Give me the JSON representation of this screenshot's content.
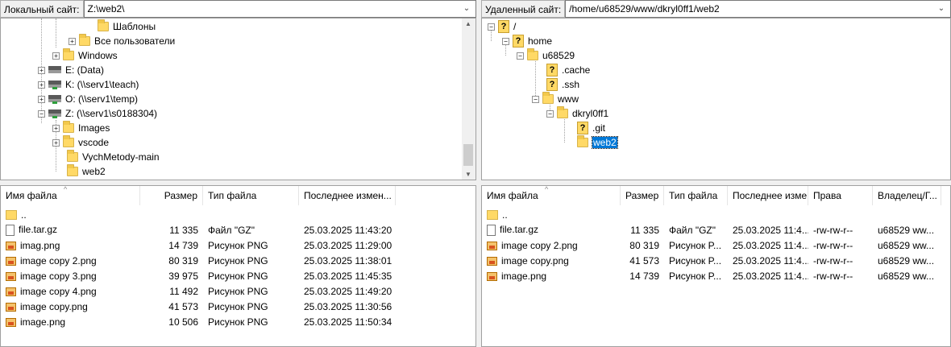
{
  "local": {
    "label": "Локальный сайт:",
    "path": "Z:\\web2\\",
    "tree": [
      {
        "label": "Шаблоны",
        "icon": "folder-icon"
      },
      {
        "label": "Все пользователи",
        "icon": "folder-icon"
      },
      {
        "label": "Windows",
        "icon": "folder-icon"
      },
      {
        "label": "E: (Data)",
        "icon": "drive-icon"
      },
      {
        "label": "K: (\\\\serv1\\teach)",
        "icon": "network-drive-icon"
      },
      {
        "label": "O: (\\\\serv1\\temp)",
        "icon": "network-drive-icon"
      },
      {
        "label": "Z: (\\\\serv1\\s0188304)",
        "icon": "network-drive-icon"
      },
      {
        "label": "Images",
        "icon": "folder-icon"
      },
      {
        "label": "vscode",
        "icon": "folder-icon"
      },
      {
        "label": "VychMetody-main",
        "icon": "folder-icon"
      },
      {
        "label": "web2",
        "icon": "folder-icon"
      }
    ],
    "columns": [
      "Имя файла",
      "Размер",
      "Тип файла",
      "Последнее измен..."
    ],
    "files": [
      {
        "name": "..",
        "size": "",
        "type": "",
        "modified": "",
        "icon": "up-folder-icon"
      },
      {
        "name": "file.tar.gz",
        "size": "11 335",
        "type": "Файл \"GZ\"",
        "modified": "25.03.2025 11:43:20",
        "icon": "file-icon"
      },
      {
        "name": "imag.png",
        "size": "14 739",
        "type": "Рисунок PNG",
        "modified": "25.03.2025 11:29:00",
        "icon": "image-icon"
      },
      {
        "name": "image copy 2.png",
        "size": "80 319",
        "type": "Рисунок PNG",
        "modified": "25.03.2025 11:38:01",
        "icon": "image-icon"
      },
      {
        "name": "image copy 3.png",
        "size": "39 975",
        "type": "Рисунок PNG",
        "modified": "25.03.2025 11:45:35",
        "icon": "image-icon"
      },
      {
        "name": "image copy 4.png",
        "size": "11 492",
        "type": "Рисунок PNG",
        "modified": "25.03.2025 11:49:20",
        "icon": "image-icon"
      },
      {
        "name": "image copy.png",
        "size": "41 573",
        "type": "Рисунок PNG",
        "modified": "25.03.2025 11:30:56",
        "icon": "image-icon"
      },
      {
        "name": "image.png",
        "size": "10 506",
        "type": "Рисунок PNG",
        "modified": "25.03.2025 11:50:34",
        "icon": "image-icon"
      }
    ]
  },
  "remote": {
    "label": "Удаленный сайт:",
    "path": "/home/u68529/www/dkryl0ff1/web2",
    "tree": [
      {
        "label": "/",
        "icon": "unknown-folder-icon"
      },
      {
        "label": "home",
        "icon": "unknown-folder-icon"
      },
      {
        "label": "u68529",
        "icon": "folder-icon"
      },
      {
        "label": ".cache",
        "icon": "unknown-folder-icon"
      },
      {
        "label": ".ssh",
        "icon": "unknown-folder-icon"
      },
      {
        "label": "www",
        "icon": "folder-icon"
      },
      {
        "label": "dkryl0ff1",
        "icon": "folder-icon"
      },
      {
        "label": ".git",
        "icon": "unknown-folder-icon"
      },
      {
        "label": "web2",
        "icon": "folder-icon"
      }
    ],
    "columns": [
      "Имя файла",
      "Размер",
      "Тип файла",
      "Последнее изме...",
      "Права",
      "Владелец/Г..."
    ],
    "files": [
      {
        "name": "..",
        "size": "",
        "type": "",
        "modified": "",
        "perms": "",
        "owner": "",
        "icon": "up-folder-icon"
      },
      {
        "name": "file.tar.gz",
        "size": "11 335",
        "type": "Файл \"GZ\"",
        "modified": "25.03.2025 11:4...",
        "perms": "-rw-rw-r--",
        "owner": "u68529 ww...",
        "icon": "file-icon"
      },
      {
        "name": "image copy 2.png",
        "size": "80 319",
        "type": "Рисунок P...",
        "modified": "25.03.2025 11:4...",
        "perms": "-rw-rw-r--",
        "owner": "u68529 ww...",
        "icon": "image-icon"
      },
      {
        "name": "image copy.png",
        "size": "41 573",
        "type": "Рисунок P...",
        "modified": "25.03.2025 11:4...",
        "perms": "-rw-rw-r--",
        "owner": "u68529 ww...",
        "icon": "image-icon"
      },
      {
        "name": "image.png",
        "size": "14 739",
        "type": "Рисунок P...",
        "modified": "25.03.2025 11:4...",
        "perms": "-rw-rw-r--",
        "owner": "u68529 ww...",
        "icon": "image-icon"
      }
    ]
  }
}
